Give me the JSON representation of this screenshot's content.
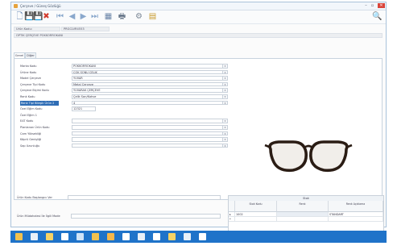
{
  "window": {
    "title": "Çerçeve / Güneş Gözlüğü",
    "controls": [
      "–",
      "▫",
      "✕"
    ]
  },
  "toolbar": {
    "buttons": [
      {
        "name": "new-document-button",
        "glyph": "🗋",
        "color": "#5a7fb0"
      },
      {
        "name": "save-button",
        "glyph": "💾",
        "color": "#3b5f9a"
      },
      {
        "name": "save-as-button",
        "glyph": "💾",
        "color": "#b03a3a"
      },
      {
        "name": "delete-button",
        "glyph": "✖",
        "color": "#d33a2c"
      },
      {
        "name": "first-record-button",
        "glyph": "⏮",
        "color": "#8aa8cc"
      },
      {
        "name": "previous-record-button",
        "glyph": "◀",
        "color": "#8aa8cc"
      },
      {
        "name": "next-record-button",
        "glyph": "▶",
        "color": "#8aa8cc"
      },
      {
        "name": "last-record-button",
        "glyph": "⏭",
        "color": "#8aa8cc"
      },
      {
        "name": "layout-button",
        "glyph": "▦",
        "color": "#6b85a8"
      },
      {
        "name": "print-button",
        "glyph": "🖶",
        "color": "#6b7a8c"
      },
      {
        "name": "settings-button",
        "glyph": "⚙",
        "color": "#7a8796"
      },
      {
        "name": "report-button",
        "glyph": "▤",
        "color": "#c89a2c"
      },
      {
        "name": "search-button",
        "glyph": "🔍",
        "color": "#6b7a8c"
      }
    ]
  },
  "header": {
    "code_label": "Ürün Kodu:",
    "code_value": "PRGCLVR4553",
    "name_value": "OPTIK ÇERÇEVE POKKORROKANI"
  },
  "tabs": [
    {
      "label": "Genel",
      "active": true
    },
    {
      "label": "Diğer",
      "active": false
    }
  ],
  "form": {
    "fields": [
      {
        "label": "Marka Kodu",
        "value": "POKKORROKANI",
        "dropdown": true
      },
      {
        "label": "Ürüne Kodu",
        "value": "ÇOK SONU ÇELIK",
        "dropdown": true
      },
      {
        "label": "Model Çerçeve",
        "value": "YUVAR",
        "dropdown": true
      },
      {
        "label": "Çerçeve Tipi Kodu",
        "value": "Metal Çerçeve",
        "dropdown": true
      },
      {
        "label": "Çerçeve Biçimi Kodu",
        "value": "YUVARAK ÇERÇEVE",
        "dropdown": true
      },
      {
        "label": "Renk Kodu",
        "value": "Çelik Sarı/Kahve",
        "dropdown": true
      },
      {
        "label": "Renk Tipi Bileşik Ürün 2",
        "value": "4",
        "dropdown": true,
        "selected": true
      },
      {
        "label": "Özel Eğim Kodu",
        "value": "12321",
        "dropdown": false,
        "short": true
      },
      {
        "label": "Özel Eğim 1",
        "value": "",
        "dropdown": false,
        "none": true
      },
      {
        "label": "EAT Kodu",
        "value": "",
        "dropdown": true
      },
      {
        "label": "Planlanan Ürün Kodu",
        "value": "",
        "dropdown": true
      },
      {
        "label": "Cam Yüksekliği",
        "value": "",
        "dropdown": true
      },
      {
        "label": "Köprü Genişliği",
        "value": "",
        "dropdown": true
      },
      {
        "label": "Sap Uzunluğu",
        "value": "",
        "dropdown": true
      }
    ],
    "bottom_fields": [
      {
        "label": "Ürün Kodu Başlangıcı Ver",
        "value": ""
      },
      {
        "label": "Ürün Müdahalesi İle İlgili Mode",
        "value": ""
      }
    ]
  },
  "grid": {
    "caption": "Stok",
    "columns": [
      "Stok Kodu",
      "Renk",
      "Renk Açıklama"
    ],
    "rows": [
      {
        "marker": "▸",
        "cells": [
          "1002",
          "",
          "STANDART"
        ]
      },
      {
        "marker": "*",
        "cells": [
          "",
          "",
          ""
        ]
      }
    ]
  },
  "taskbar": {
    "items": [
      {
        "name": "start-icon",
        "color": "#f2c14e"
      },
      {
        "name": "calculator-icon",
        "color": "#e8f0f8"
      },
      {
        "name": "notes-icon",
        "color": "#f6d365"
      },
      {
        "name": "document-icon",
        "color": "#ffffff"
      },
      {
        "name": "glasses-app-icon",
        "color": "#cfe3f7"
      },
      {
        "name": "tag-icon",
        "color": "#f2c14e"
      },
      {
        "name": "box-icon",
        "color": "#f6b74b"
      },
      {
        "name": "tree-icon",
        "color": "#ffffff"
      },
      {
        "name": "globe-icon",
        "color": "#e8f0f8"
      },
      {
        "name": "network-icon",
        "color": "#ffffff"
      },
      {
        "name": "folder-icon",
        "color": "#f6d365"
      },
      {
        "name": "people-icon",
        "color": "#e8f0f8"
      },
      {
        "name": "monitor-icon",
        "color": "#ffffff"
      }
    ]
  }
}
